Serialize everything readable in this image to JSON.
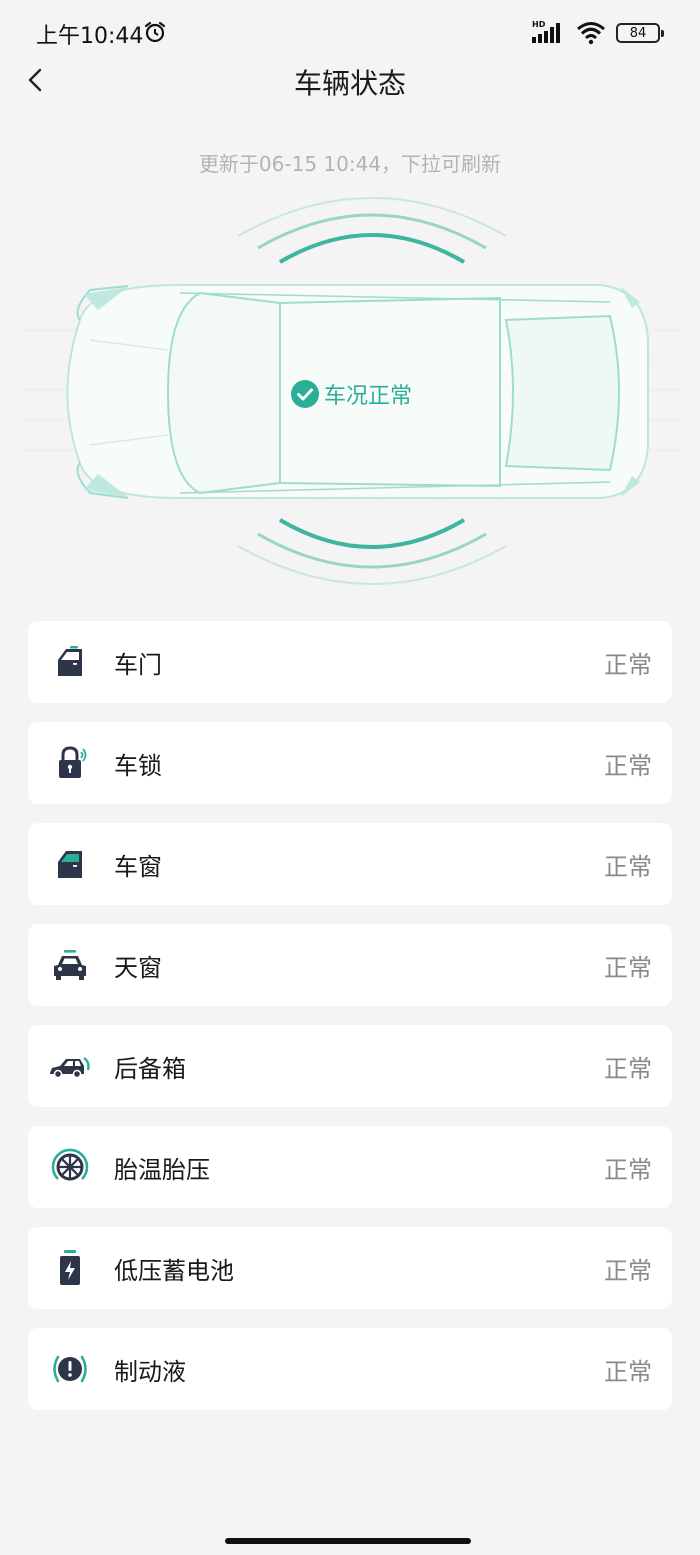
{
  "status_bar": {
    "time": "上午10:44",
    "hd": "HD",
    "battery": "84"
  },
  "nav": {
    "title": "车辆状态"
  },
  "update_text": "更新于06-15 10:44，下拉可刷新",
  "car": {
    "status_text": "车况正常"
  },
  "colors": {
    "accent": "#2aae96",
    "icon_dark": "#2e3548"
  },
  "items": [
    {
      "label": "车门",
      "value": "正常",
      "icon": "car-door-icon"
    },
    {
      "label": "车锁",
      "value": "正常",
      "icon": "lock-icon"
    },
    {
      "label": "车窗",
      "value": "正常",
      "icon": "car-window-icon"
    },
    {
      "label": "天窗",
      "value": "正常",
      "icon": "sunroof-icon"
    },
    {
      "label": "后备箱",
      "value": "正常",
      "icon": "trunk-icon"
    },
    {
      "label": "胎温胎压",
      "value": "正常",
      "icon": "tire-icon"
    },
    {
      "label": "低压蓄电池",
      "value": "正常",
      "icon": "battery-icon"
    },
    {
      "label": "制动液",
      "value": "正常",
      "icon": "brake-fluid-icon"
    }
  ]
}
